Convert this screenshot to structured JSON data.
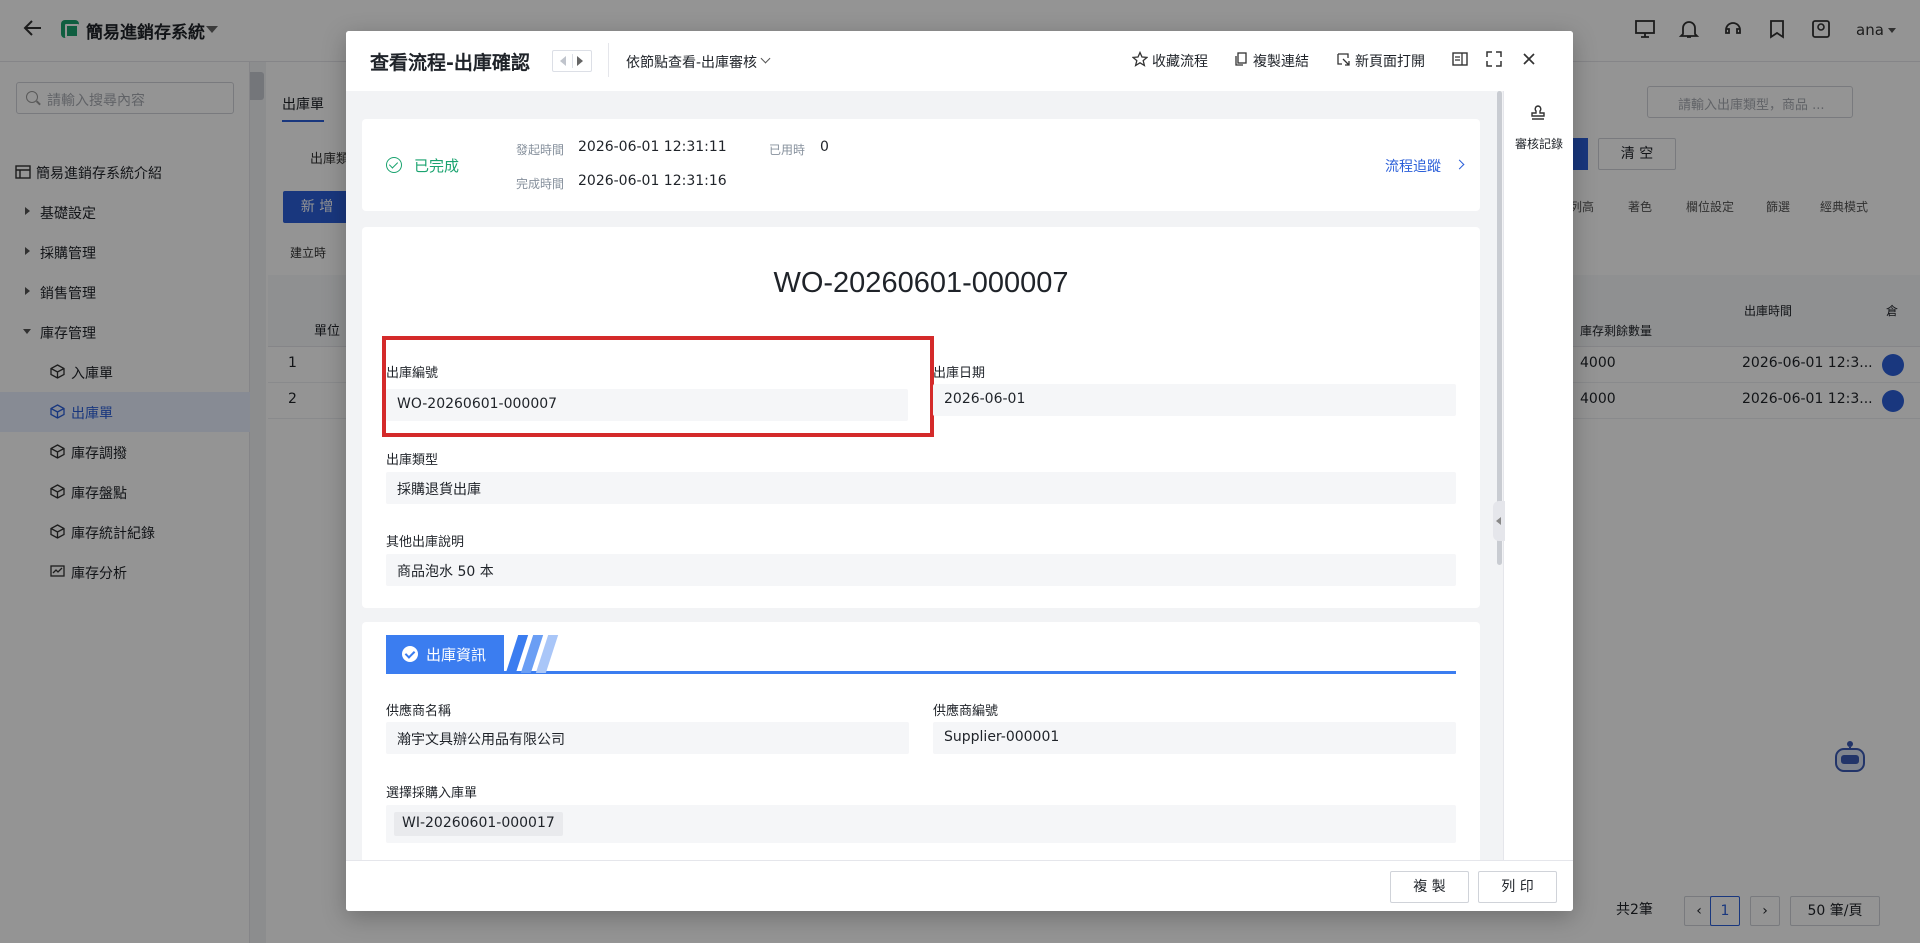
{
  "app": {
    "title": "簡易進銷存系統",
    "user": "ana"
  },
  "sidebar": {
    "search_placeholder": "請輸入搜尋內容",
    "items": [
      {
        "label": "簡易進銷存系統介紹"
      },
      {
        "label": "基礎設定"
      },
      {
        "label": "採購管理"
      },
      {
        "label": "銷售管理"
      },
      {
        "label": "庫存管理"
      },
      {
        "label": "入庫單"
      },
      {
        "label": "出庫單"
      },
      {
        "label": "庫存調撥"
      },
      {
        "label": "庫存盤點"
      },
      {
        "label": "庫存統計紀錄"
      },
      {
        "label": "庫存分析"
      }
    ]
  },
  "background": {
    "tab": "出庫單",
    "sub_tab": "出庫類",
    "new_button": "新 增",
    "sort_label": "建立時",
    "search_placeholder": "請輸入出庫類型，商品 ...",
    "clear_button": "清 空",
    "tools": [
      "列高",
      "著色",
      "欄位設定",
      "篩選",
      "經典模式"
    ],
    "columns": {
      "unit": "單位",
      "remaining": "庫存剩餘數量",
      "time": "出庫時間",
      "warehouse": "倉"
    },
    "rows": [
      {
        "index": "1",
        "remaining": "4000",
        "time": "2026-06-01 12:3..."
      },
      {
        "index": "2",
        "remaining": "4000",
        "time": "2026-06-01 12:3..."
      }
    ],
    "pager": {
      "total": "共2筆",
      "page": "1",
      "size": "50 筆/頁"
    }
  },
  "modal": {
    "title": "查看流程-出庫確認",
    "node_view": "依節點查看-出庫審核",
    "actions": {
      "favorite": "收藏流程",
      "copy_link": "複製連結",
      "open_new": "新頁面打開"
    },
    "right_panel": {
      "audit_label": "審核記錄"
    },
    "status": {
      "state": "已完成",
      "start_label": "發起時間",
      "start_value": "2026-06-01 12:31:11",
      "elapsed_label": "已用時",
      "elapsed_value": "0",
      "end_label": "完成時間",
      "end_value": "2026-06-01 12:31:16",
      "trace_link": "流程追蹤"
    },
    "doc": {
      "title": "WO-20260601-000007",
      "fields": {
        "out_no_label": "出庫編號",
        "out_no_value": "WO-20260601-000007",
        "out_date_label": "出庫日期",
        "out_date_value": "2026-06-01",
        "out_type_label": "出庫類型",
        "out_type_value": "採購退貨出庫",
        "note_label": "其他出庫說明",
        "note_value": "商品泡水 50 本"
      }
    },
    "section": {
      "title": "出庫資訊",
      "supplier_name_label": "供應商名稱",
      "supplier_name_value": "瀚宇文具辦公用品有限公司",
      "supplier_no_label": "供應商編號",
      "supplier_no_value": "Supplier-000001",
      "purchase_label": "選擇採購入庫單",
      "purchase_value": "WI-20260601-000017"
    },
    "footer": {
      "copy_button": "複 製",
      "print_button": "列 印"
    }
  },
  "colors": {
    "accent": "#2b5fd9",
    "success": "#1aa36f",
    "highlight": "#d42a2a",
    "section": "#3b7df0"
  }
}
